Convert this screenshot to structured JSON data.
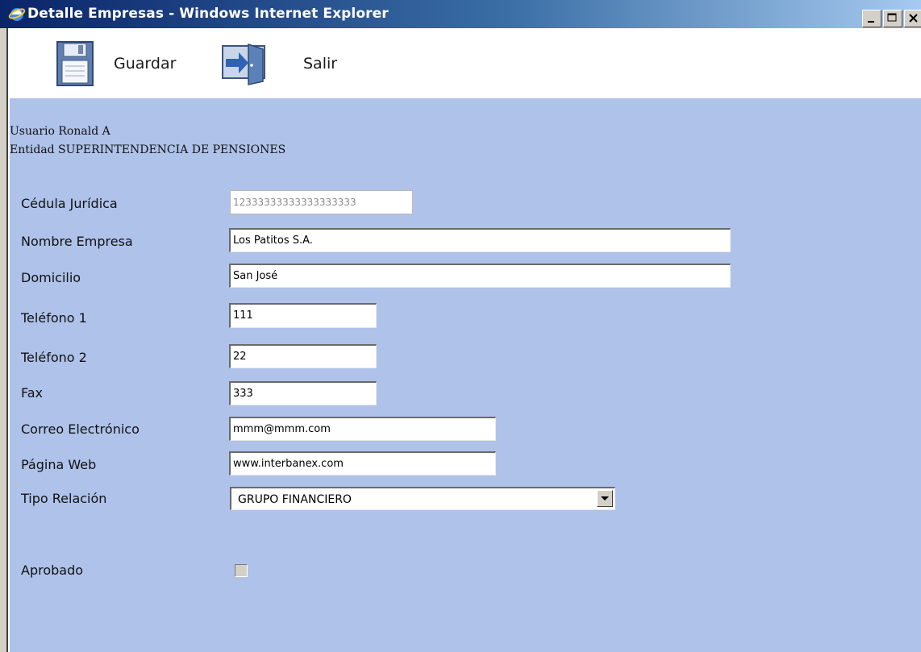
{
  "window": {
    "title": "Detalle Empresas - Windows Internet Explorer"
  },
  "toolbar": {
    "save_label": "Guardar",
    "exit_label": "Salir"
  },
  "user_info": {
    "user_line": "Usuario Ronald A",
    "entity_line": "Entidad SUPERINTENDENCIA DE PENSIONES"
  },
  "form": {
    "cedula": {
      "label": "Cédula Jurídica",
      "value": "12333333333333333333"
    },
    "nombre": {
      "label": "Nombre Empresa",
      "value": "Los Patitos S.A."
    },
    "domicilio": {
      "label": "Domicilio",
      "value": "San José"
    },
    "telefono1": {
      "label": "Teléfono 1",
      "value": "111"
    },
    "telefono2": {
      "label": "Teléfono 2",
      "value": "22"
    },
    "fax": {
      "label": "Fax",
      "value": "333"
    },
    "correo": {
      "label": "Correo Electrónico",
      "value": "mmm@mmm.com"
    },
    "web": {
      "label": "Página Web",
      "value": "www.interbanex.com"
    },
    "tipo_relacion": {
      "label": "Tipo Relación",
      "value": "GRUPO FINANCIERO"
    },
    "aprobado": {
      "label": "Aprobado",
      "checked": false
    }
  },
  "colors": {
    "content_bg": "#aec2ea",
    "titlebar_start": "#0a246a",
    "titlebar_end": "#a6caf0"
  }
}
